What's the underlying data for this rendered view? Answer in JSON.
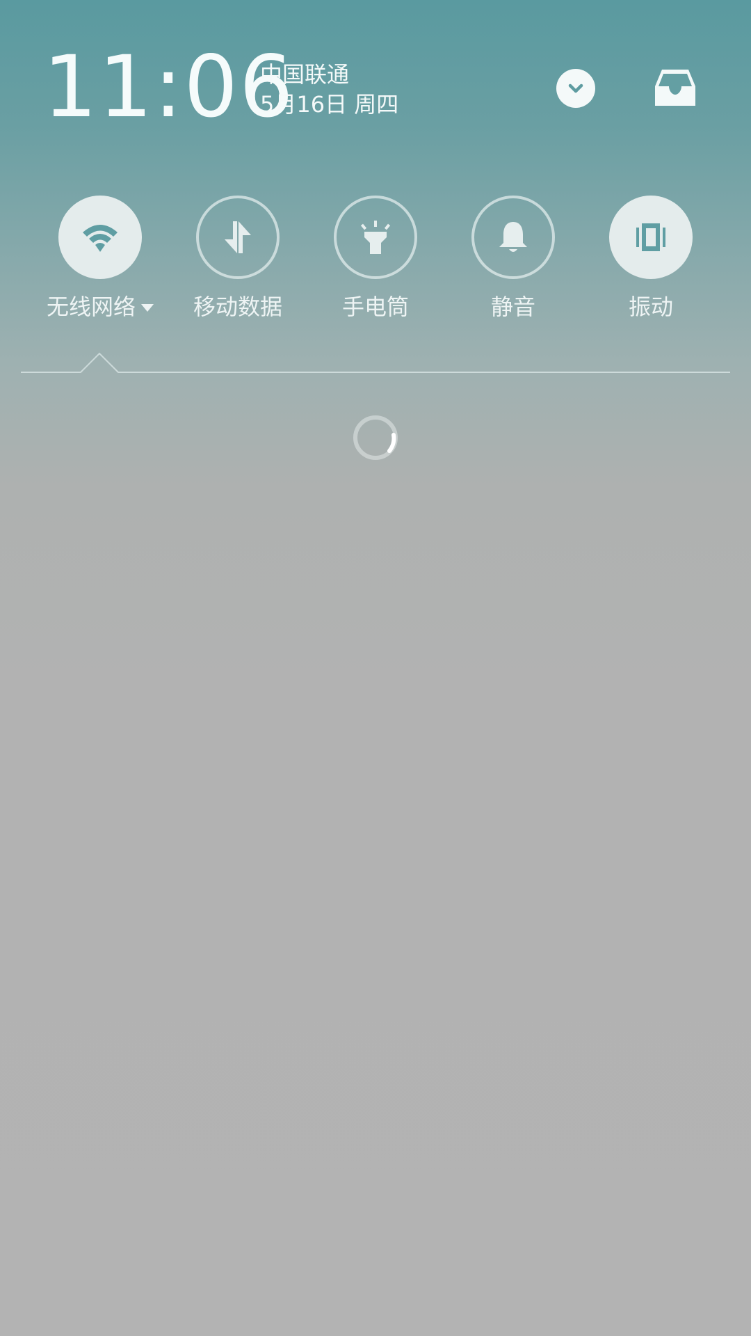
{
  "header": {
    "clock": "11:06",
    "carrier": "中国联通",
    "date": "5月16日 周四",
    "collapse_icon": "chevron-down-icon",
    "inbox_icon": "inbox-tray-icon"
  },
  "toggles": [
    {
      "label": "无线网络",
      "icon": "wifi-icon",
      "state": "on",
      "has_dropdown": true
    },
    {
      "label": "移动数据",
      "icon": "mobile-data-arrows-icon",
      "state": "off"
    },
    {
      "label": "手电筒",
      "icon": "flashlight-icon",
      "state": "off"
    },
    {
      "label": "静音",
      "icon": "bell-icon",
      "state": "off"
    },
    {
      "label": "振动",
      "icon": "vibrate-icon",
      "state": "on"
    }
  ],
  "status": {
    "loading": true
  },
  "colors": {
    "accent_teal": "#5a9aa0",
    "toggle_on_fill": "#e4ecec",
    "icon_on_color": "#5f9ea3"
  }
}
